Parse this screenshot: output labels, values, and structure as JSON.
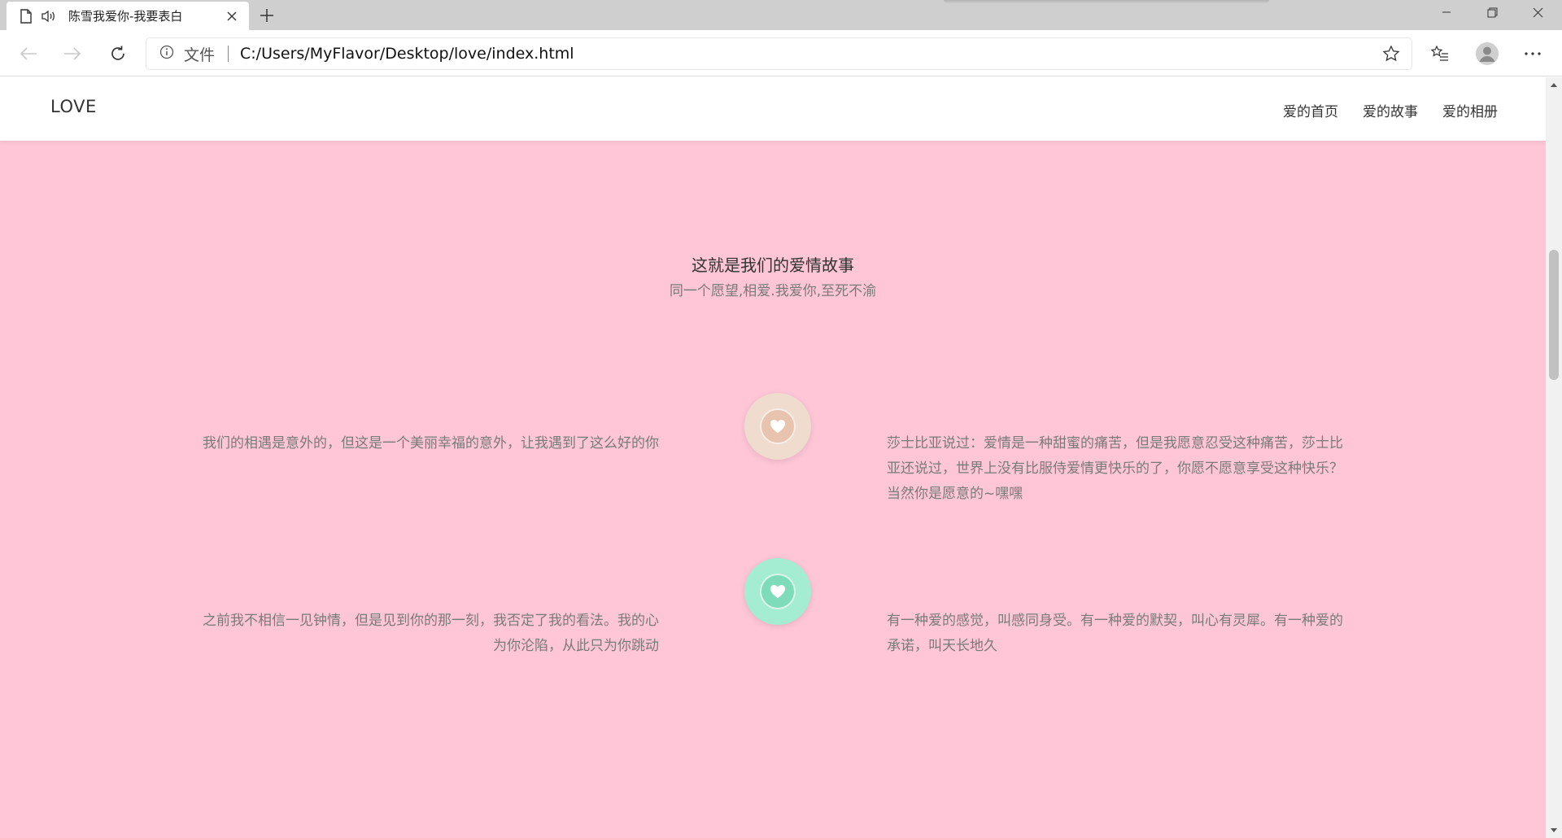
{
  "browser": {
    "tab": {
      "title": "陈雪我爱你-我要表白"
    },
    "address": {
      "scheme": "文件",
      "url": "C:/Users/MyFlavor/Desktop/love/index.html"
    }
  },
  "site": {
    "logo": "LOVE",
    "nav": [
      "爱的首页",
      "爱的故事",
      "爱的相册"
    ]
  },
  "story": {
    "title": "这就是我们的爱情故事",
    "subtitle": "同一个愿望,相爱.我爱你,至死不渝",
    "items": [
      {
        "left": "我们的相遇是意外的，但这是一个美丽幸福的意外，让我遇到了这么好的你",
        "right": "莎士比亚说过：爱情是一种甜蜜的痛苦，但是我愿意忍受这种痛苦，莎士比亚还说过，世界上没有比服侍爱情更快乐的了，你愿不愿意享受这种快乐？当然你是愿意的~嘿嘿",
        "circle_color": "#f0dbcf",
        "heart_color": "#e8c3ad"
      },
      {
        "left": "之前我不相信一见钟情，但是见到你的那一刻，我否定了我的看法。我的心为你沦陷，从此只为你跳动",
        "right": "有一种爱的感觉，叫感同身受。有一种爱的默契，叫心有灵犀。有一种爱的承诺，叫天长地久",
        "circle_color": "#a4ecd2",
        "heart_color": "#7fdcba"
      }
    ]
  },
  "colors": {
    "page_background": "#fec6d6",
    "header_background": "#ffffff",
    "body_text": "#7a7a7a"
  }
}
